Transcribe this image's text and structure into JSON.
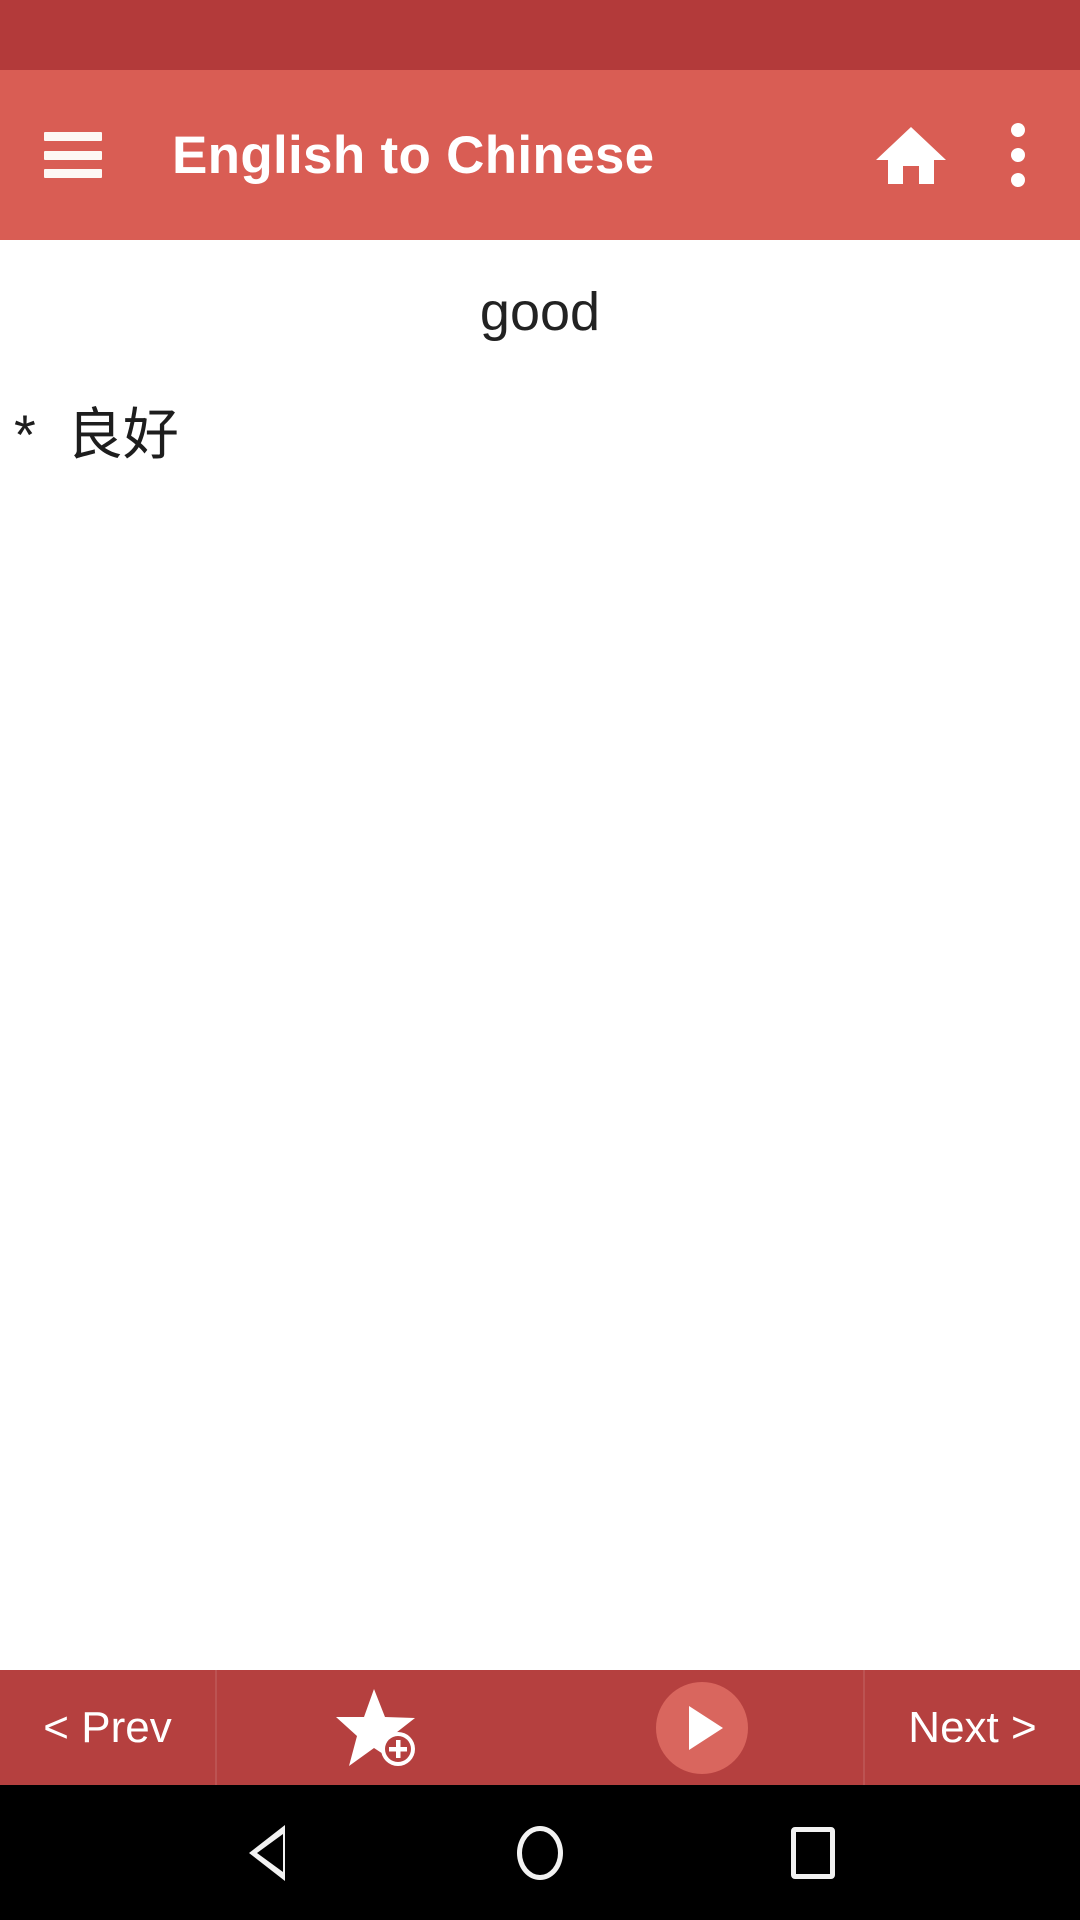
{
  "app": {
    "title": "English to Chinese",
    "status_bar_color": "#b33a3a",
    "app_bar_color": "#d95d54",
    "bottom_bar_color": "#b5403f",
    "accent_color": "#d9665e",
    "content_bg": "#ffffff"
  },
  "app_bar": {
    "menu_icon": "hamburger-menu-icon",
    "home_icon": "home-icon",
    "overflow_icon": "overflow-menu-icon"
  },
  "content": {
    "headword": "good",
    "translations": [
      "*  良好"
    ]
  },
  "bottom_bar": {
    "prev_label": "< Prev",
    "star_icon": "star-add-icon",
    "play_icon": "play-icon",
    "next_label": "Next >"
  },
  "nav_bar": {
    "back_icon": "back-triangle-icon",
    "home_icon": "home-circle-icon",
    "recents_icon": "recents-square-icon"
  }
}
